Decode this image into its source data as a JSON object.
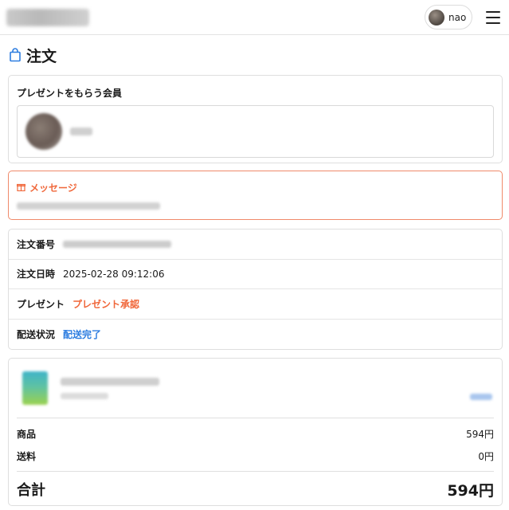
{
  "header": {
    "user_name": "nao"
  },
  "page": {
    "title": "注文"
  },
  "member": {
    "section_label": "プレゼントをもらう会員"
  },
  "message": {
    "label": "メッセージ"
  },
  "order_info": {
    "order_number_label": "注文番号",
    "order_datetime_label": "注文日時",
    "order_datetime_value": "2025-02-28 09:12:06",
    "present_label": "プレゼント",
    "present_status": "プレゼント承認",
    "delivery_label": "配送状況",
    "delivery_status": "配送完了"
  },
  "summary": {
    "item_label": "商品",
    "item_value": "594円",
    "shipping_label": "送料",
    "shipping_value": "0円",
    "total_label": "合計",
    "total_value": "594円"
  },
  "colors": {
    "accent_orange": "#f0673a",
    "link_blue": "#2d7de0",
    "message_border": "#f08a6a"
  },
  "icons": {
    "bag": "shopping-bag-icon",
    "gift": "gift-icon",
    "menu": "hamburger-menu-icon"
  }
}
